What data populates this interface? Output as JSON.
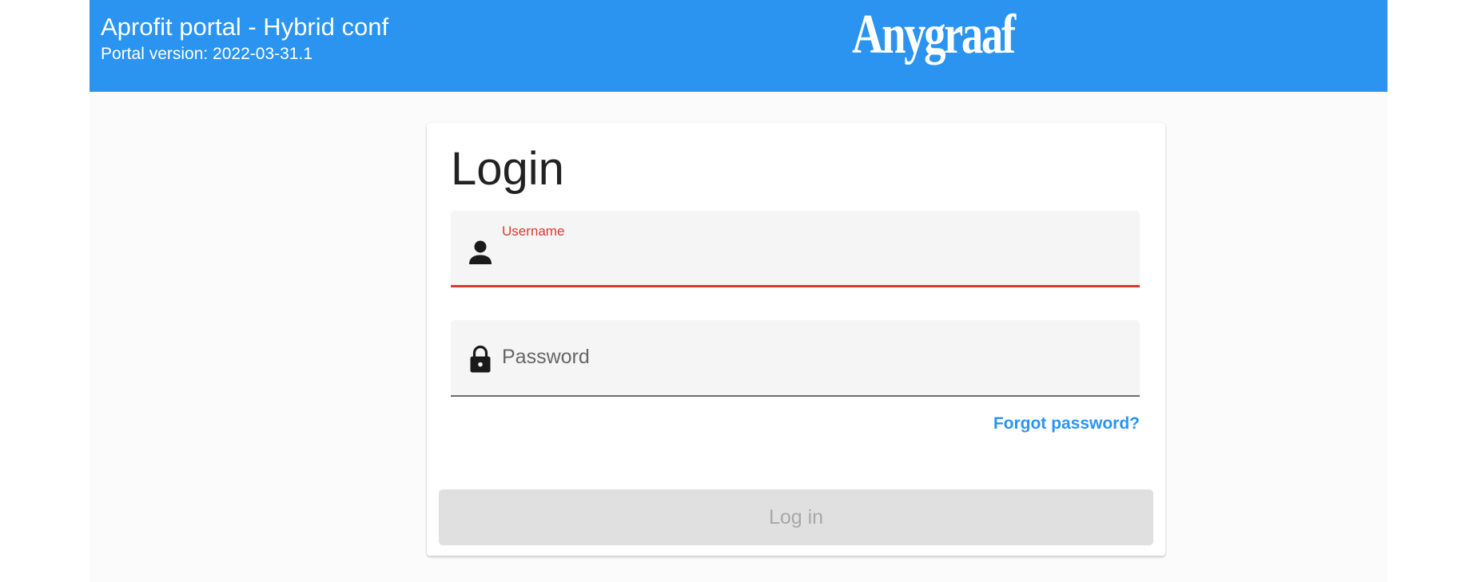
{
  "header": {
    "title": "Aprofit portal - Hybrid conf",
    "version": "Portal version: 2022-03-31.1",
    "logo": "Anygraaf",
    "background_color": "#2a94f0"
  },
  "login": {
    "title": "Login",
    "username": {
      "label": "Username",
      "value": "",
      "icon": "person-icon",
      "accent_color": "#d93b30"
    },
    "password": {
      "placeholder": "Password",
      "value": "",
      "icon": "lock-icon"
    },
    "forgot_password": "Forgot password?",
    "submit_label": "Log in"
  }
}
